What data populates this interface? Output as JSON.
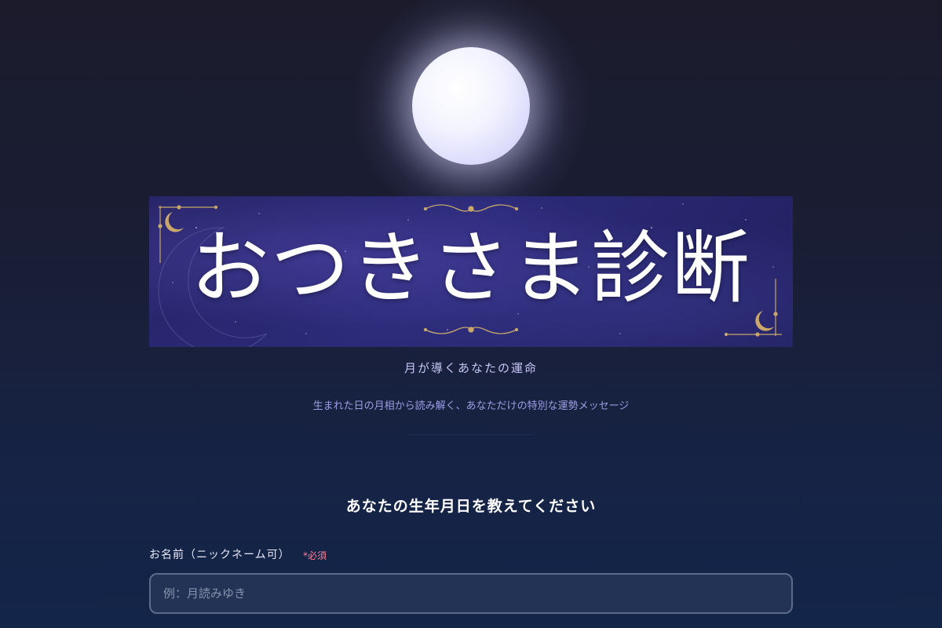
{
  "hero": {
    "title": "おつきさま診断",
    "tagline": "月が導くあなたの運命",
    "description": "生まれた日の月相から読み解く、あなただけの特別な運勢メッセージ"
  },
  "form": {
    "heading": "あなたの生年月日を教えてください",
    "name_label": "お名前（ニックネーム可）",
    "required_badge": "*必須",
    "name_placeholder": "例：月読みゆき",
    "name_value": ""
  },
  "colors": {
    "background_top": "#1b1b2c",
    "background_bottom": "#132549",
    "banner": "#2b2a78",
    "accent_gold": "#c9a86a",
    "required": "#ff7d93"
  }
}
